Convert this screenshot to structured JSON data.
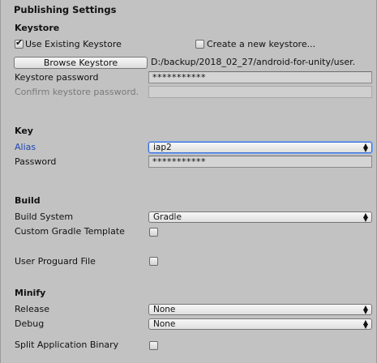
{
  "title": "Publishing Settings",
  "keystore": {
    "heading": "Keystore",
    "use_existing_label": "Use Existing Keystore",
    "use_existing_checked": true,
    "create_new_label": "Create a new keystore...",
    "create_new_checked": false,
    "browse_label": "Browse Keystore",
    "path": "D:/backup/2018_02_27/android-for-unity/user.",
    "password_label": "Keystore password",
    "password_value": "***********",
    "confirm_label": "Confirm keystore password.",
    "confirm_value": ""
  },
  "key": {
    "heading": "Key",
    "alias_label": "Alias",
    "alias_value": "iap2",
    "password_label": "Password",
    "password_value": "***********"
  },
  "build": {
    "heading": "Build",
    "system_label": "Build System",
    "system_value": "Gradle",
    "gradle_template_label": "Custom Gradle Template",
    "gradle_template_checked": false,
    "proguard_label": "User Proguard File",
    "proguard_checked": false
  },
  "minify": {
    "heading": "Minify",
    "release_label": "Release",
    "release_value": "None",
    "debug_label": "Debug",
    "debug_value": "None"
  },
  "split_binary": {
    "label": "Split Application Binary",
    "checked": false
  },
  "icons": {
    "check": "✔",
    "dropdown_arrows": "up-down-arrows"
  }
}
